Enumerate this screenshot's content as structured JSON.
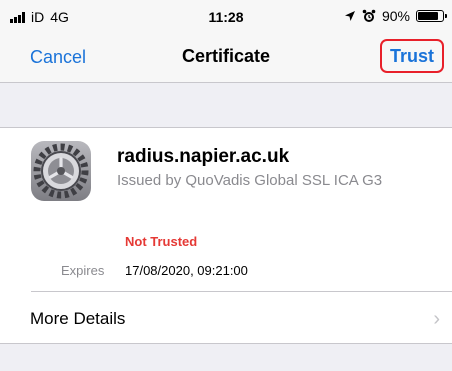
{
  "status_bar": {
    "carrier": "iD",
    "network": "4G",
    "time": "11:28",
    "battery_percent": "90%",
    "battery_level": 0.9
  },
  "nav": {
    "cancel_label": "Cancel",
    "title": "Certificate",
    "trust_label": "Trust",
    "highlight_color": "#e8202a",
    "link_color": "#1a73d9"
  },
  "certificate": {
    "name": "radius.napier.ac.uk",
    "issuer": "Issued by QuoVadis Global SSL ICA G3",
    "status": "Not Trusted",
    "status_color": "#e53935",
    "expires_label": "Expires",
    "expires_value": "17/08/2020, 09:21:00",
    "icon": "settings-gear-icon"
  },
  "details_row": {
    "label": "More Details",
    "icon": "chevron-right-icon"
  }
}
